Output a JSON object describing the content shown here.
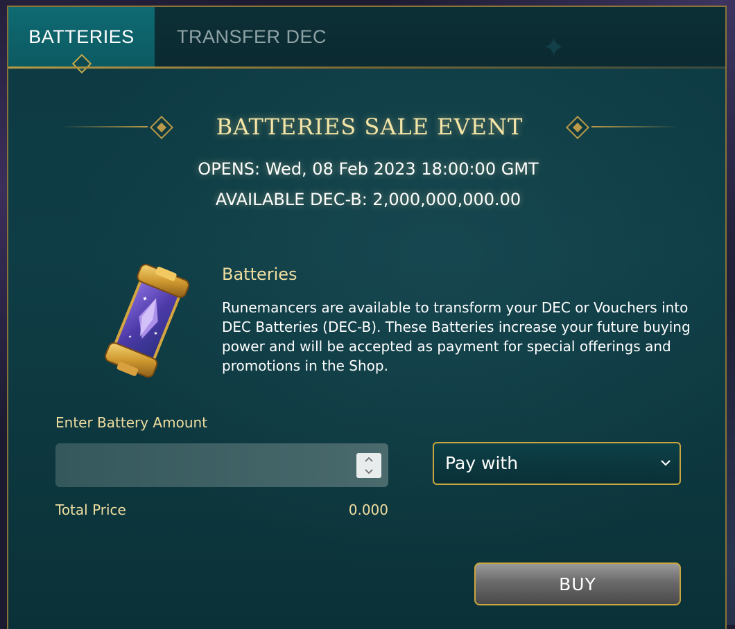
{
  "tabs": [
    {
      "label": "BATTERIES",
      "active": true
    },
    {
      "label": "TRANSFER DEC",
      "active": false
    }
  ],
  "event": {
    "title": "BATTERIES SALE EVENT",
    "opens": "OPENS: Wed, 08 Feb 2023 18:00:00 GMT",
    "available": "AVAILABLE DEC-B: 2,000,000,000.00"
  },
  "product": {
    "title": "Batteries",
    "description": "Runemancers are available to transform your DEC or Vouchers into DEC Batteries (DEC-B). These Batteries increase your future buying power and will be accepted as payment for special offerings and promotions in the Shop.",
    "icon": "battery-icon"
  },
  "form": {
    "amount_label": "Enter Battery Amount",
    "amount_value": "",
    "total_label": "Total Price",
    "total_value": "0.000",
    "pay_with_label": "Pay with",
    "buy_label": "BUY"
  },
  "colors": {
    "accent_gold": "#c9a640",
    "heading_gold": "#f5e6a8",
    "panel_teal": "#0f3d45",
    "active_tab": "#0f6a72"
  }
}
